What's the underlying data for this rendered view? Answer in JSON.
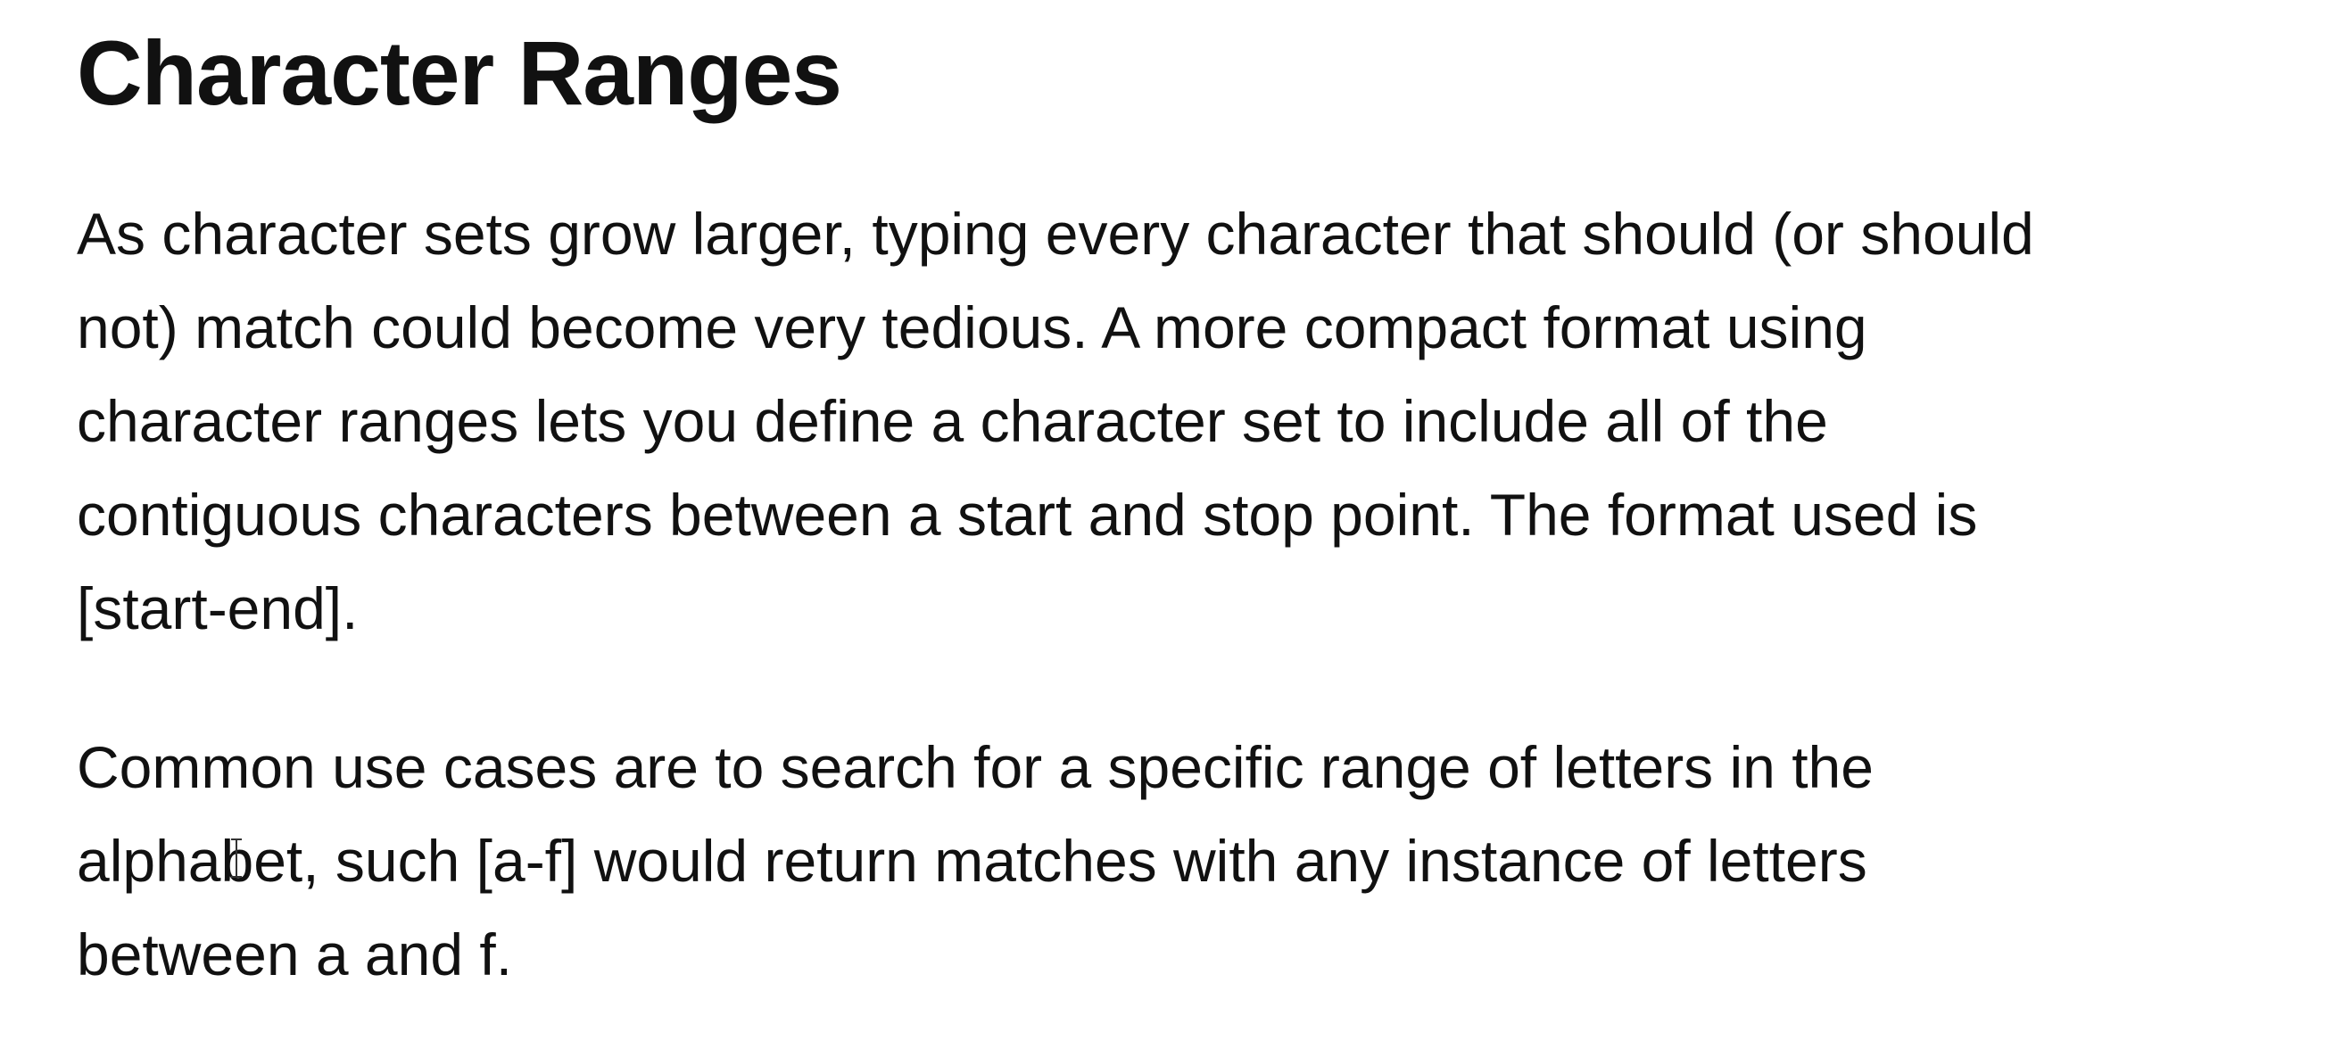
{
  "document": {
    "title": "Character Ranges",
    "paragraphs": [
      {
        "lines": [
          "As character sets grow larger, typing every character that should (or should",
          "not) match could become very tedious. A more compact format using",
          "character ranges lets you define a character set to include all of the",
          "contiguous characters between a start and stop point. The format used is",
          "[start-end]."
        ]
      },
      {
        "lines": [
          "Common use cases are to search for a specific range of letters in the",
          "alphabet, such [a-f] would return matches with any instance of letters",
          "between a and f."
        ]
      }
    ]
  },
  "cursor": {
    "type": "text-ibeam-icon"
  }
}
